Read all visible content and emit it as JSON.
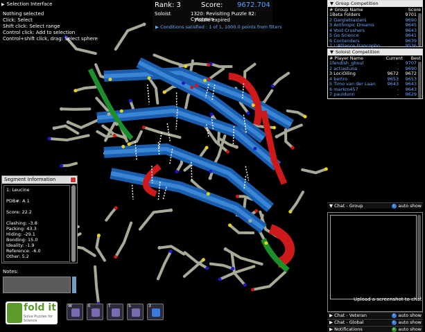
{
  "selection_interface": {
    "title": "Selection Interface",
    "lines": [
      "Nothing selected",
      "Click: Select",
      "Shift click: Select range",
      "Control click: Add to selection",
      "Control+shift click, drag: Select sphere"
    ]
  },
  "score": {
    "rank_label": "Rank: 3",
    "score_label": "Score:",
    "score_value": "9672.704",
    "mode": "Soloist",
    "puzzle": "1320: Revisiting Puzzle 82: Cytotoxin",
    "status": "Puzzle expired",
    "conditions": "Conditions satisfied : 1 of 1, 1000.0 points from filters"
  },
  "group_competition": {
    "title": "Group Competition",
    "headers": [
      "# Group Name",
      "Score"
    ],
    "rows": [
      {
        "name": "1Beta Folders",
        "score": "9701",
        "me": true
      },
      {
        "name": "2 Gargleblasters",
        "score": "9690"
      },
      {
        "name": "3 Anthropic Dreams",
        "score": "9645"
      },
      {
        "name": "4 Void Crushers",
        "score": "9643"
      },
      {
        "name": "5 Go Science",
        "score": "9641"
      },
      {
        "name": "6 Contenders",
        "score": "9639"
      },
      {
        "name": "7 L'Alliance Francopho...",
        "score": "9536"
      }
    ]
  },
  "soloist_competition": {
    "title": "Soloist Competition",
    "headers": [
      "# Player Name",
      "Current",
      "Best"
    ],
    "rows": [
      {
        "name": "1fendish_ghoul",
        "current": "-",
        "best": "9707"
      },
      {
        "name": "2 actiastuna",
        "current": "-",
        "best": "9690"
      },
      {
        "name": "3 LociOiling",
        "current": "9672",
        "best": "9672",
        "me": true
      },
      {
        "name": "4 bertro",
        "current": "9653",
        "best": "9653"
      },
      {
        "name": "5 Timo van der Laan",
        "current": "9643",
        "best": "9643"
      },
      {
        "name": "6 markm457",
        "current": "-",
        "best": "9643"
      },
      {
        "name": "7 pauldunn",
        "current": "-",
        "best": "9629"
      }
    ]
  },
  "segment_info": {
    "title": "Segment Information",
    "lines": [
      "1: Leucine",
      "",
      "PDB#: A 1",
      "",
      "Score: 22.2",
      "",
      "Clashing: -3.8",
      "Packing: 43.3",
      "Hiding: -29.1",
      "Bonding: 15.0",
      "Ideality: -1.9",
      "Reference: -6.0",
      "Other: 5.2"
    ]
  },
  "notes": {
    "label": "Notes:"
  },
  "chat": {
    "group": "Chat - Group",
    "veteran": "Chat - Veteran",
    "global": "Chat - Global",
    "notifications": "Notifications",
    "auto_show": "auto show",
    "upload": "Upload a screenshot to chat",
    "info_glyph": "i",
    "x_glyph": "x"
  },
  "logo": {
    "text": "fold it",
    "sub": "Solve Puzzles for Science"
  },
  "tools": [
    {
      "key": "W",
      "color": "#7a6ab0",
      "icon": "wiggle-icon"
    },
    {
      "key": "E",
      "color": "#7a6ab0",
      "icon": "shake-icon"
    },
    {
      "key": "T",
      "color": "#7a6ab0",
      "icon": "tweak-icon"
    },
    {
      "key": "S",
      "color": "#7a6ab0",
      "icon": "shake-sidechains-icon"
    },
    {
      "key": "3",
      "color": "#3a7ad8",
      "icon": "move-icon"
    }
  ]
}
